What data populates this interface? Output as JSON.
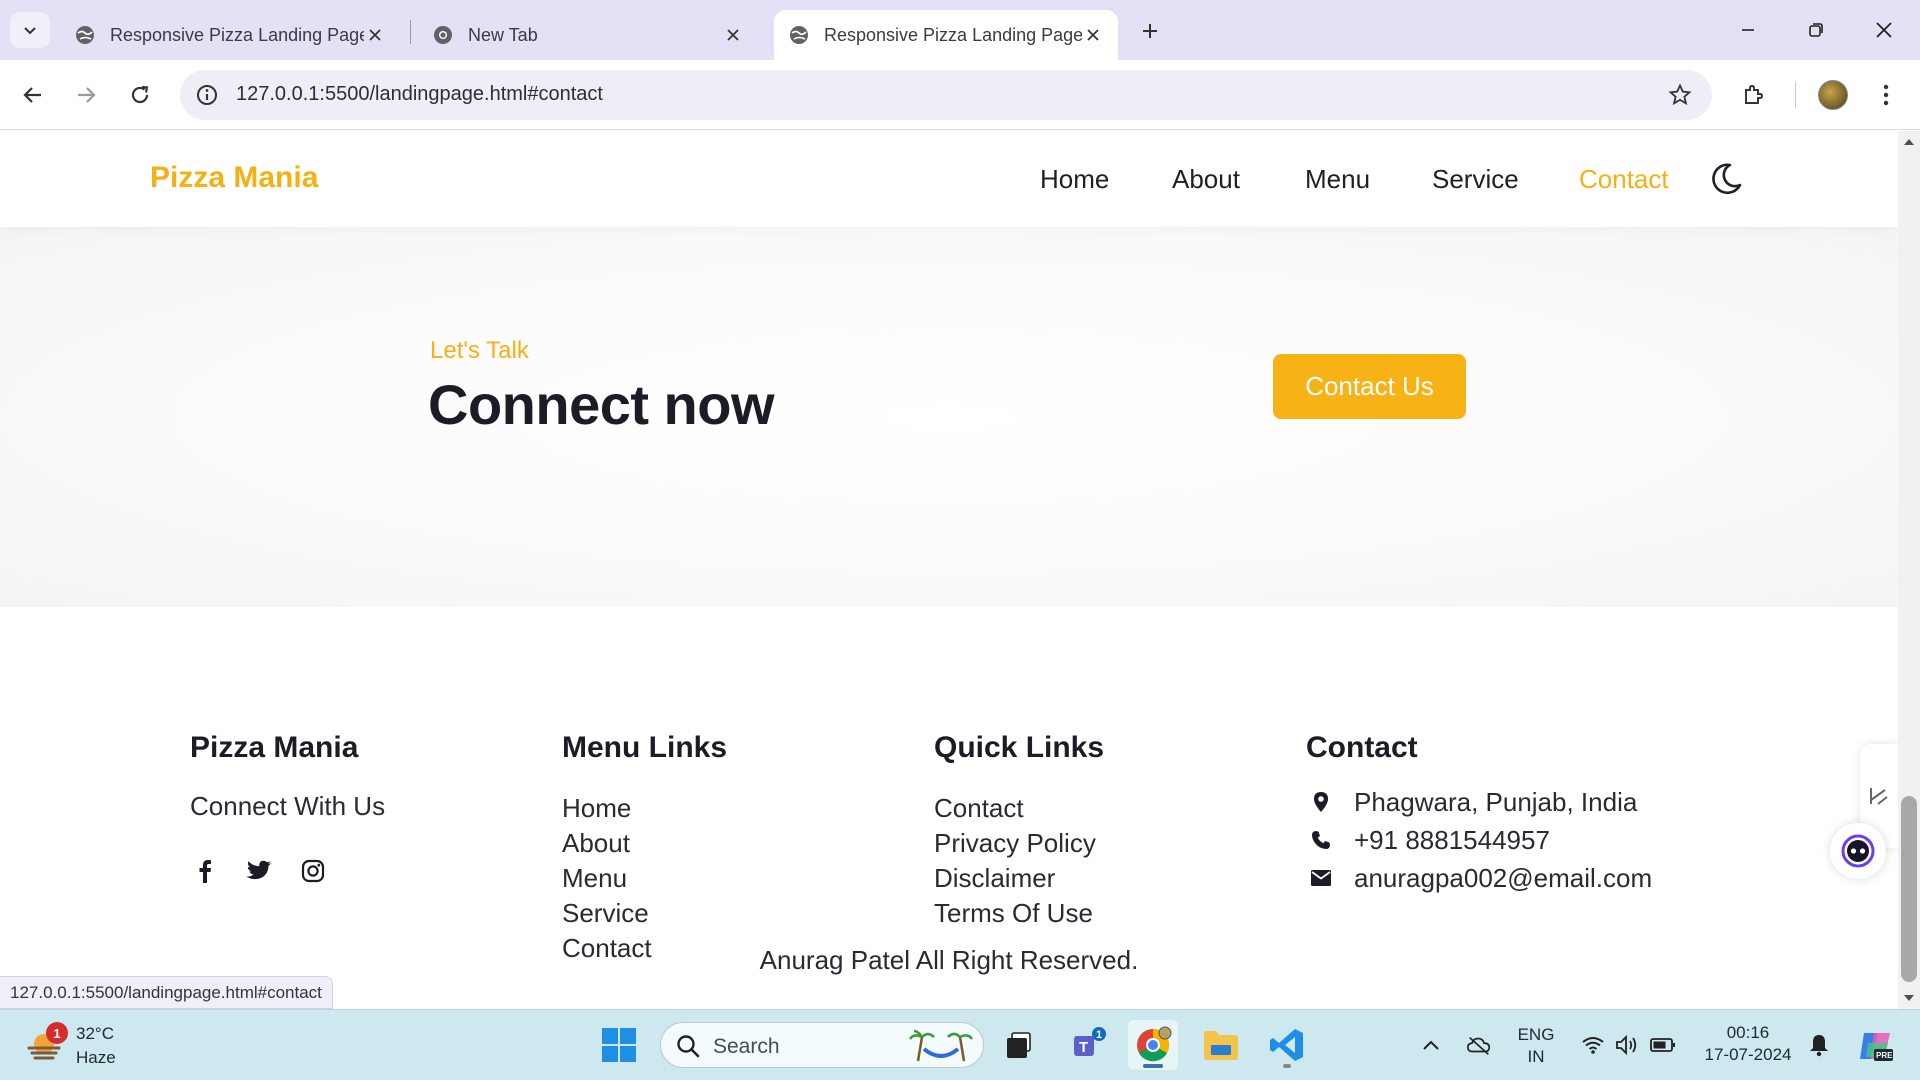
{
  "browser": {
    "tabs": [
      {
        "title": "Responsive Pizza Landing Page",
        "active": false
      },
      {
        "title": "New Tab",
        "active": false
      },
      {
        "title": "Responsive Pizza Landing Page",
        "active": true
      }
    ],
    "url": "127.0.0.1:5500/landingpage.html#contact",
    "status_url": "127.0.0.1:5500/landingpage.html#contact"
  },
  "site": {
    "brand": "Pizza Mania",
    "nav": {
      "home": "Home",
      "about": "About",
      "menu": "Menu",
      "service": "Service",
      "contact": "Contact",
      "active": "Contact"
    },
    "cta": {
      "kicker": "Let's Talk",
      "headline": "Connect now",
      "button": "Contact Us"
    },
    "footer": {
      "brand_title": "Pizza Mania",
      "connect_text": "Connect With Us",
      "social": [
        "facebook-icon",
        "twitter-icon",
        "instagram-icon"
      ],
      "menu_title": "Menu Links",
      "menu_links": [
        "Home",
        "About",
        "Menu",
        "Service",
        "Contact"
      ],
      "quick_title": "Quick Links",
      "quick_links": [
        "Contact",
        "Privacy Policy",
        "Disclaimer",
        "Terms Of Use"
      ],
      "contact_title": "Contact",
      "contact_items": [
        {
          "icon": "location-pin-icon",
          "text": "Phagwara, Punjab, India"
        },
        {
          "icon": "phone-icon",
          "text": "+91 8881544957"
        },
        {
          "icon": "mail-icon",
          "text": "anuragpa002@email.com"
        }
      ],
      "copyright": "Anurag Patel All Right Reserved."
    }
  },
  "taskbar": {
    "weather": {
      "temp": "32°C",
      "condition": "Haze",
      "badge": "1"
    },
    "search_placeholder": "Search",
    "teams_badge": "1",
    "lang_top": "ENG",
    "lang_bottom": "IN",
    "time": "00:16",
    "date": "17-07-2024"
  },
  "colors": {
    "accent": "#f5b016",
    "button": "#f7b316",
    "heading": "#1c1b26",
    "tabstrip": "#e3e1f5",
    "taskbar": "#cde8ee"
  }
}
